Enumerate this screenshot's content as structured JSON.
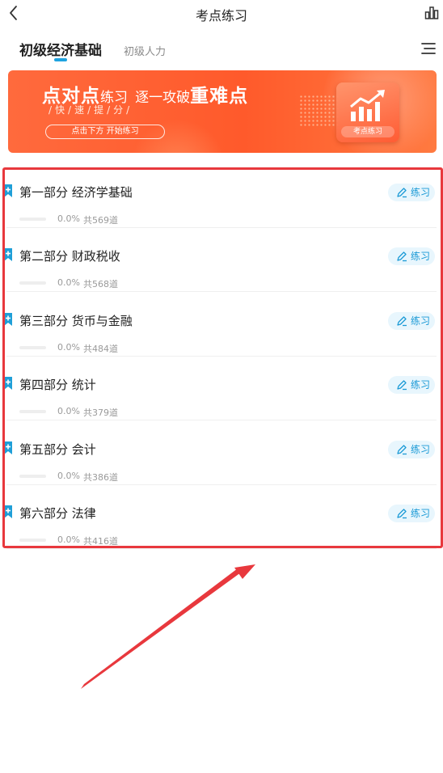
{
  "header": {
    "title": "考点练习",
    "back_icon": "chevron-left-icon",
    "stats_icon": "bar-chart-icon"
  },
  "tabs": {
    "active": "初级经济基础",
    "inactive": "初级人力",
    "menu_icon": "menu-icon",
    "accent": "#1fa3e0"
  },
  "banner": {
    "line1_big_a": "点对点",
    "line1_small": "练习",
    "line1_big_b": "逐一攻破",
    "line1_big_c": "重难点",
    "line2": "/快/速/提/分/",
    "pill": "点击下方 开始练习",
    "icon_label": "考点练习",
    "color": "#ff5a2b"
  },
  "list": {
    "practice_label": "练习",
    "items": [
      {
        "title": "第一部分 经济学基础",
        "percent": "0.0%",
        "total": "共569道",
        "progress": 0
      },
      {
        "title": "第二部分 财政税收",
        "percent": "0.0%",
        "total": "共568道",
        "progress": 0
      },
      {
        "title": "第三部分 货币与金融",
        "percent": "0.0%",
        "total": "共484道",
        "progress": 0
      },
      {
        "title": "第四部分 统计",
        "percent": "0.0%",
        "total": "共379道",
        "progress": 0
      },
      {
        "title": "第五部分 会计",
        "percent": "0.0%",
        "total": "共386道",
        "progress": 0
      },
      {
        "title": "第六部分 法律",
        "percent": "0.0%",
        "total": "共416道",
        "progress": 0
      }
    ]
  },
  "annotation": {
    "frame_color": "#e8383d",
    "arrow_color": "#e8383d"
  }
}
